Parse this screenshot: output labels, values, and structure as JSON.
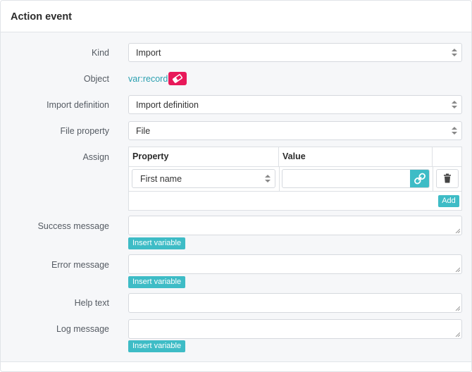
{
  "panel": {
    "title": "Action event"
  },
  "form": {
    "kind": {
      "label": "Kind",
      "value": "Import"
    },
    "object": {
      "label": "Object",
      "value": "var:record"
    },
    "import_definition": {
      "label": "Import definition",
      "value": "Import definition"
    },
    "file_property": {
      "label": "File property",
      "value": "File"
    },
    "assign": {
      "label": "Assign",
      "columns": [
        "Property",
        "Value"
      ],
      "rows": [
        {
          "property": "First name",
          "value": ""
        }
      ],
      "add_label": "Add"
    },
    "success_message": {
      "label": "Success message",
      "value": "",
      "insert_label": "Insert variable"
    },
    "error_message": {
      "label": "Error message",
      "value": "",
      "insert_label": "Insert variable"
    },
    "help_text": {
      "label": "Help text",
      "value": ""
    },
    "log_message": {
      "label": "Log message",
      "value": "",
      "insert_label": "Insert variable"
    }
  },
  "icons": {
    "object_clear": "eraser-icon",
    "row_link": "link-icon",
    "row_delete": "trash-icon",
    "select_caret": "sort-caret-icon"
  },
  "colors": {
    "accent": "#3ebcc6",
    "danger": "#e8195a",
    "link": "#2a9fb0"
  }
}
